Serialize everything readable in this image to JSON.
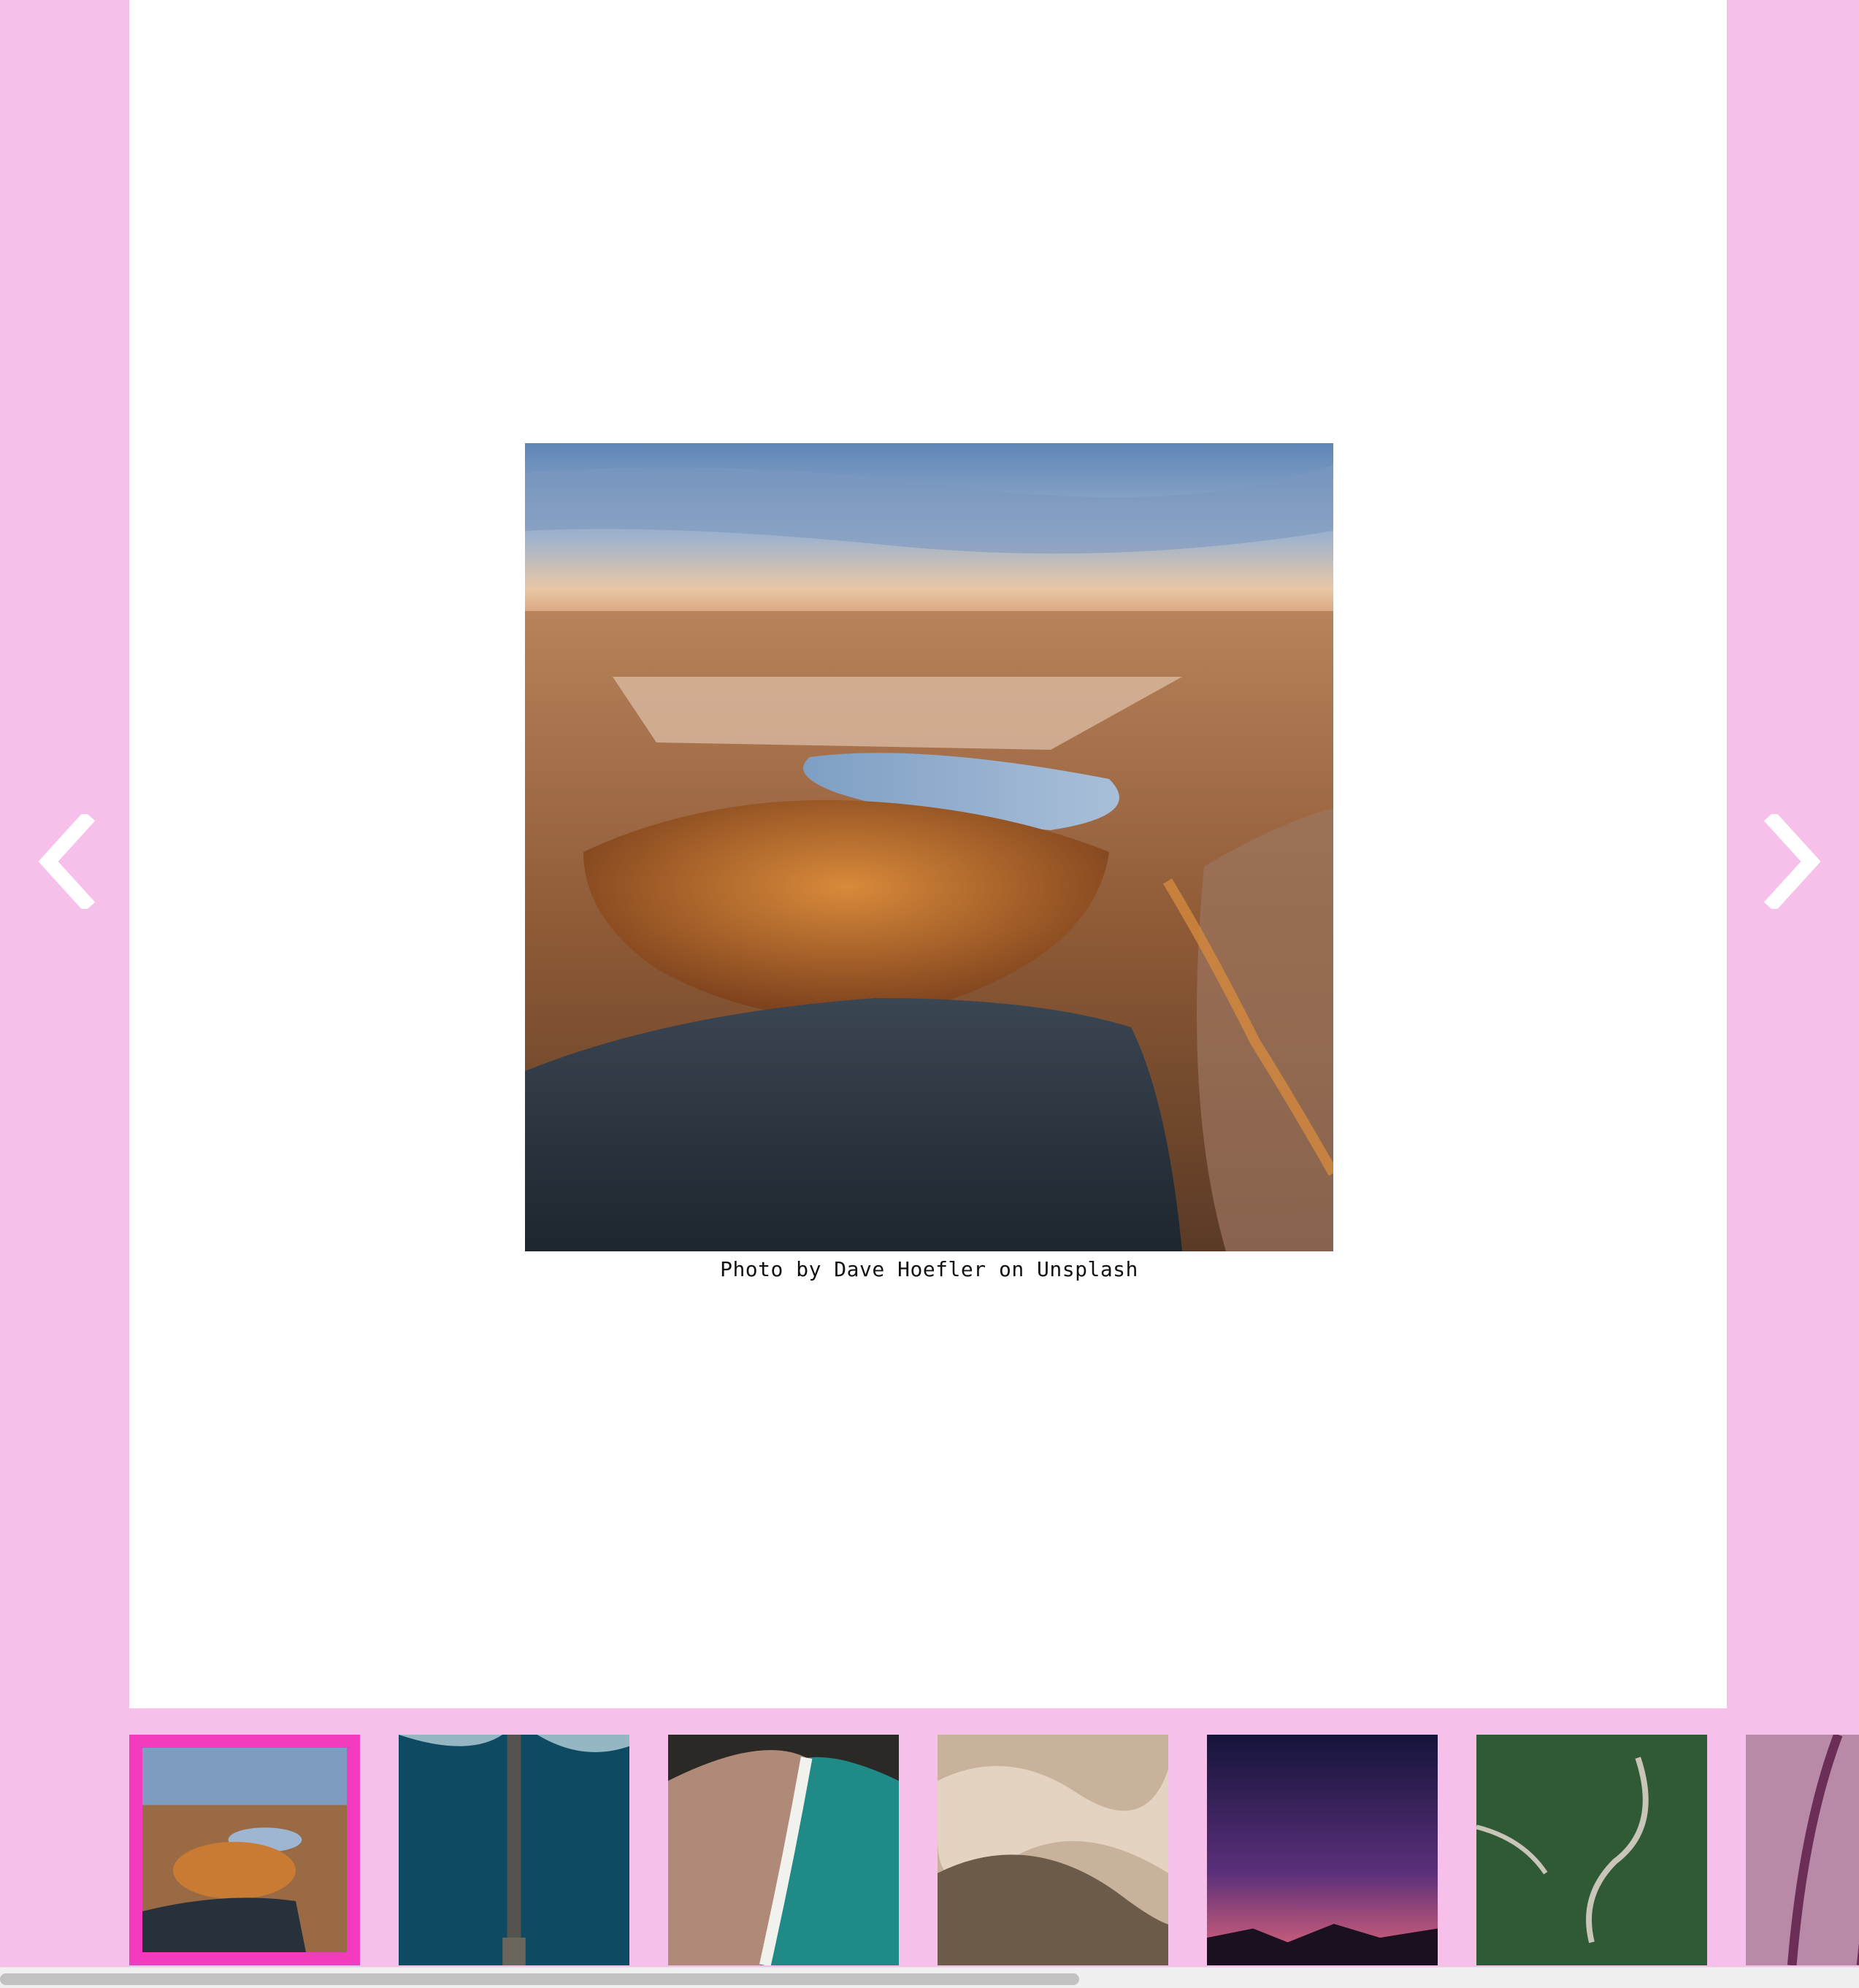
{
  "gallery": {
    "caption": "Photo by Dave Hoefler on Unsplash",
    "active_index": 0,
    "thumbnails": [
      {
        "label": "aerial-autumn-lakes"
      },
      {
        "label": "aerial-ocean-pier"
      },
      {
        "label": "aerial-beach-shoreline"
      },
      {
        "label": "sand-dunes"
      },
      {
        "label": "night-sky-stars"
      },
      {
        "label": "green-mountain-road"
      },
      {
        "label": "purple-grass"
      }
    ]
  },
  "colors": {
    "background": "#f7c0ea",
    "panel": "#ffffff",
    "active_border": "#f23bbf"
  },
  "icons": {
    "prev": "chevron-left-icon",
    "next": "chevron-right-icon"
  },
  "scrollbar": {
    "position": 0.0
  }
}
